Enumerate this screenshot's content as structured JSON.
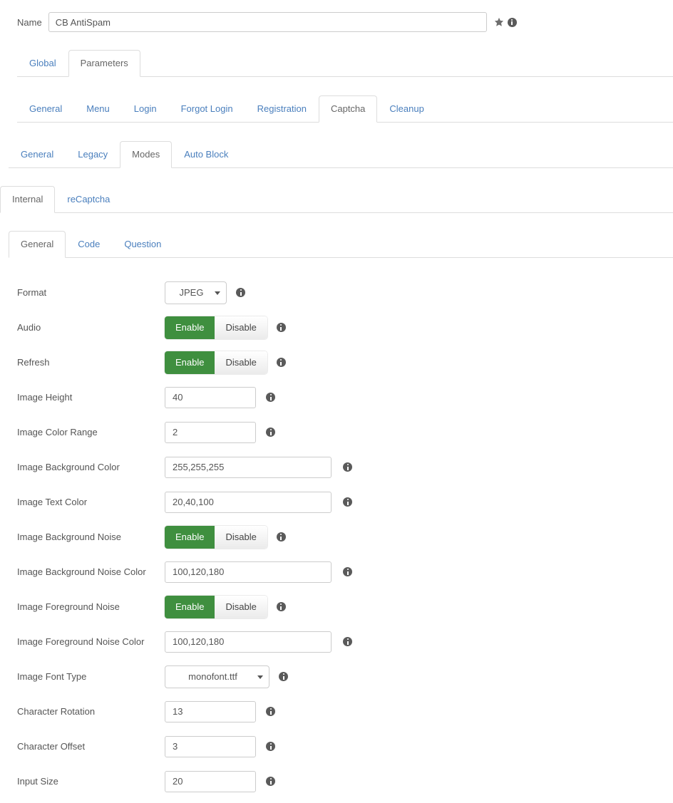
{
  "header": {
    "name_label": "Name",
    "name_value": "CB AntiSpam",
    "favorite_icon": "star-icon",
    "info_icon": "info-icon"
  },
  "tabs_level1": [
    {
      "label": "Global",
      "active": false
    },
    {
      "label": "Parameters",
      "active": true
    }
  ],
  "tabs_level2": [
    {
      "label": "General",
      "active": false
    },
    {
      "label": "Menu",
      "active": false
    },
    {
      "label": "Login",
      "active": false
    },
    {
      "label": "Forgot Login",
      "active": false
    },
    {
      "label": "Registration",
      "active": false
    },
    {
      "label": "Captcha",
      "active": true
    },
    {
      "label": "Cleanup",
      "active": false
    }
  ],
  "tabs_level3": [
    {
      "label": "General",
      "active": false
    },
    {
      "label": "Legacy",
      "active": false
    },
    {
      "label": "Modes",
      "active": true
    },
    {
      "label": "Auto Block",
      "active": false
    }
  ],
  "tabs_level4": [
    {
      "label": "Internal",
      "active": true
    },
    {
      "label": "reCaptcha",
      "active": false
    }
  ],
  "tabs_level5": [
    {
      "label": "General",
      "active": true
    },
    {
      "label": "Code",
      "active": false
    },
    {
      "label": "Question",
      "active": false
    }
  ],
  "toggle_labels": {
    "on": "Enable",
    "off": "Disable"
  },
  "colors": {
    "enable_green": "#3f8f3f",
    "link_blue": "#4a7fbd",
    "label_gray": "#555555",
    "border_gray": "#cccccc",
    "tab_border": "#dddddd"
  },
  "fields": [
    {
      "label": "Format",
      "type": "select",
      "value": "JPEG",
      "width": "s-format"
    },
    {
      "label": "Audio",
      "type": "toggle",
      "value": "Enable"
    },
    {
      "label": "Refresh",
      "type": "toggle",
      "value": "Enable"
    },
    {
      "label": "Image Height",
      "type": "text",
      "value": "40",
      "width": "narrow"
    },
    {
      "label": "Image Color Range",
      "type": "text",
      "value": "2",
      "width": "narrow"
    },
    {
      "label": "Image Background Color",
      "type": "text",
      "value": "255,255,255",
      "width": "wide"
    },
    {
      "label": "Image Text Color",
      "type": "text",
      "value": "20,40,100",
      "width": "wide"
    },
    {
      "label": "Image Background Noise",
      "type": "toggle",
      "value": "Enable"
    },
    {
      "label": "Image Background Noise Color",
      "type": "text",
      "value": "100,120,180",
      "width": "wide"
    },
    {
      "label": "Image Foreground Noise",
      "type": "toggle",
      "value": "Enable"
    },
    {
      "label": "Image Foreground Noise Color",
      "type": "text",
      "value": "100,120,180",
      "width": "wide"
    },
    {
      "label": "Image Font Type",
      "type": "select",
      "value": "monofont.ttf",
      "width": "s-font"
    },
    {
      "label": "Character Rotation",
      "type": "text",
      "value": "13",
      "width": "narrow"
    },
    {
      "label": "Character Offset",
      "type": "text",
      "value": "3",
      "width": "narrow"
    },
    {
      "label": "Input Size",
      "type": "text",
      "value": "20",
      "width": "narrow"
    }
  ]
}
